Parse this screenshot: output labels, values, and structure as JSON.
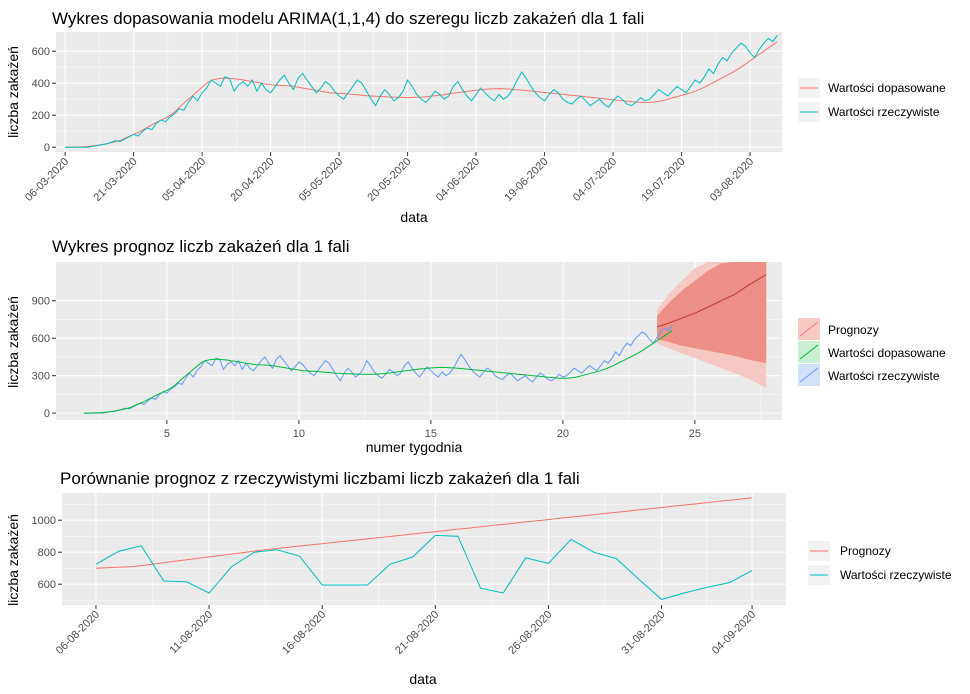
{
  "chart_data": [
    {
      "type": "line",
      "title": "Wykres dopasowania modelu ARIMA(1,1,4) do szeregu liczb zakażeń dla 1 fali",
      "xlabel": "data",
      "ylabel": "liczba zakażeń",
      "x_ticks": [
        "06-03-2020",
        "21-03-2020",
        "05-04-2020",
        "20-04-2020",
        "05-05-2020",
        "20-05-2020",
        "04-06-2020",
        "19-06-2020",
        "04-07-2020",
        "19-07-2020",
        "03-08-2020"
      ],
      "y_ticks": [
        0,
        200,
        400,
        600
      ],
      "ylim": [
        -30,
        720
      ],
      "xlim": [
        -2,
        157
      ],
      "legend_position": "right",
      "series": [
        {
          "name": "Wartości dopasowane",
          "color": "#F8766D",
          "values": [
            0,
            0,
            1,
            2,
            3,
            5,
            8,
            12,
            16,
            22,
            28,
            34,
            42,
            55,
            68,
            80,
            92,
            108,
            124,
            140,
            155,
            170,
            182,
            200,
            220,
            248,
            275,
            300,
            325,
            350,
            375,
            400,
            418,
            425,
            430,
            432,
            430,
            428,
            425,
            420,
            415,
            410,
            405,
            400,
            395,
            390,
            388,
            386,
            385,
            383,
            380,
            375,
            370,
            365,
            360,
            355,
            350,
            345,
            340,
            338,
            336,
            335,
            333,
            330,
            328,
            325,
            322,
            320,
            318,
            316,
            315,
            314,
            313,
            312,
            311,
            310,
            311,
            312,
            313,
            315,
            318,
            321,
            325,
            329,
            333,
            337,
            341,
            345,
            349,
            353,
            356,
            359,
            362,
            364,
            365,
            366,
            365,
            364,
            362,
            360,
            357,
            354,
            351,
            348,
            345,
            342,
            339,
            336,
            333,
            330,
            327,
            324,
            321,
            318,
            315,
            312,
            309,
            306,
            303,
            300,
            297,
            294,
            291,
            288,
            285,
            282,
            280,
            279,
            280,
            282,
            286,
            292,
            300,
            308,
            316,
            324,
            332,
            340,
            350,
            362,
            375,
            390,
            405,
            420,
            435,
            450,
            465,
            482,
            500,
            520,
            540,
            560,
            580,
            600,
            620,
            640,
            660
          ]
        },
        {
          "name": "Wartości rzeczywiste",
          "color": "#00BFC4",
          "values": [
            0,
            0,
            0,
            0,
            0,
            0,
            5,
            10,
            15,
            20,
            30,
            40,
            35,
            50,
            65,
            80,
            70,
            100,
            120,
            110,
            150,
            170,
            160,
            190,
            210,
            240,
            230,
            280,
            320,
            290,
            340,
            370,
            420,
            400,
            380,
            440,
            430,
            350,
            390,
            410,
            380,
            420,
            350,
            400,
            360,
            340,
            380,
            420,
            450,
            400,
            360,
            430,
            460,
            420,
            380,
            340,
            370,
            410,
            390,
            350,
            320,
            300,
            340,
            380,
            420,
            400,
            350,
            300,
            260,
            320,
            360,
            330,
            290,
            310,
            350,
            420,
            380,
            330,
            300,
            280,
            310,
            350,
            330,
            300,
            320,
            380,
            410,
            360,
            320,
            290,
            330,
            370,
            340,
            310,
            290,
            330,
            300,
            320,
            360,
            420,
            470,
            430,
            380,
            340,
            310,
            290,
            330,
            360,
            340,
            300,
            280,
            270,
            300,
            320,
            290,
            260,
            280,
            300,
            270,
            250,
            290,
            320,
            300,
            270,
            260,
            280,
            310,
            290,
            300,
            330,
            360,
            340,
            320,
            350,
            380,
            360,
            340,
            380,
            420,
            400,
            440,
            490,
            460,
            520,
            560,
            540,
            590,
            620,
            650,
            630,
            590,
            560,
            610,
            650,
            680,
            660,
            700
          ]
        }
      ]
    },
    {
      "type": "line",
      "title": "Wykres prognoz liczb zakażeń dla 1 fali",
      "xlabel": "numer tygodnia",
      "ylabel": "liczba zakażeń",
      "x_ticks": [
        5,
        10,
        15,
        20,
        25
      ],
      "y_ticks": [
        0,
        300,
        600,
        900
      ],
      "ylim": [
        -55,
        1210
      ],
      "xlim": [
        0.8,
        28.3
      ],
      "legend_position": "right",
      "x_start": 1.857,
      "x_step": 0.142857,
      "series": [
        {
          "name": "Prognozy",
          "color": "#F8766D"
        },
        {
          "name": "Wartości dopasowane",
          "color": "#00BA38"
        },
        {
          "name": "Wartości rzeczywiste",
          "color": "#619CFF"
        }
      ],
      "forecast": {
        "x": [
          23.57,
          24.0,
          24.5,
          25.0,
          25.5,
          26.0,
          26.5,
          27.0,
          27.7
        ],
        "mean": [
          690,
          720,
          760,
          800,
          850,
          900,
          950,
          1020,
          1110
        ],
        "lo80": [
          590,
          570,
          540,
          520,
          500,
          480,
          460,
          430,
          400
        ],
        "hi80": [
          780,
          880,
          980,
          1060,
          1140,
          1200,
          1260,
          1320,
          1380
        ],
        "lo95": [
          560,
          520,
          480,
          440,
          400,
          360,
          320,
          280,
          200
        ],
        "hi95": [
          830,
          950,
          1060,
          1160,
          1250,
          1330,
          1400,
          1460,
          1520
        ]
      }
    },
    {
      "type": "line",
      "title": "Porównanie prognoz z rzeczywistymi liczbami liczb zakażeń dla 1 fali",
      "xlabel": "data",
      "ylabel": "liczba zakażeń",
      "x_ticks": [
        "06-08-2020",
        "11-08-2020",
        "16-08-2020",
        "21-08-2020",
        "26-08-2020",
        "31-08-2020",
        "04-09-2020"
      ],
      "x_tick_positions": [
        0,
        5,
        10,
        15,
        20,
        25,
        29
      ],
      "y_ticks": [
        600,
        800,
        1000
      ],
      "ylim": [
        470,
        1170
      ],
      "xlim": [
        -1.5,
        30.5
      ],
      "legend_position": "right",
      "series": [
        {
          "name": "Prognozy",
          "color": "#F8766D",
          "values": [
            700,
            705,
            710,
            725,
            740,
            755,
            770,
            785,
            800,
            815,
            828,
            840,
            852,
            865,
            877,
            890,
            902,
            915,
            927,
            940,
            952,
            965,
            977,
            990,
            1002,
            1015,
            1027,
            1040,
            1052,
            1065,
            1077,
            1090,
            1102,
            1115,
            1127,
            1140
          ]
        },
        {
          "name": "Wartości rzeczywiste",
          "color": "#00BFC4",
          "values": [
            725,
            805,
            840,
            620,
            615,
            545,
            710,
            800,
            815,
            775,
            595,
            595,
            595,
            725,
            770,
            905,
            900,
            575,
            545,
            765,
            730,
            880,
            800,
            760,
            630,
            505,
            545,
            580,
            610,
            685
          ]
        }
      ]
    }
  ],
  "ui": {
    "title1": "Wykres dopasowania modelu ARIMA(1,1,4) do szeregu liczb zakażeń dla 1 fali",
    "title2": "Wykres prognoz liczb zakażeń dla 1 fali",
    "title3": "Porównanie prognoz z rzeczywistymi liczbami liczb zakażeń dla 1 fali",
    "ylabel": "liczba zakażeń",
    "xlabel_date": "data",
    "xlabel_week": "numer tygodnia",
    "legend_fitted": "Wartości dopasowane",
    "legend_actual": "Wartości rzeczywiste",
    "legend_forecast": "Prognozy"
  }
}
